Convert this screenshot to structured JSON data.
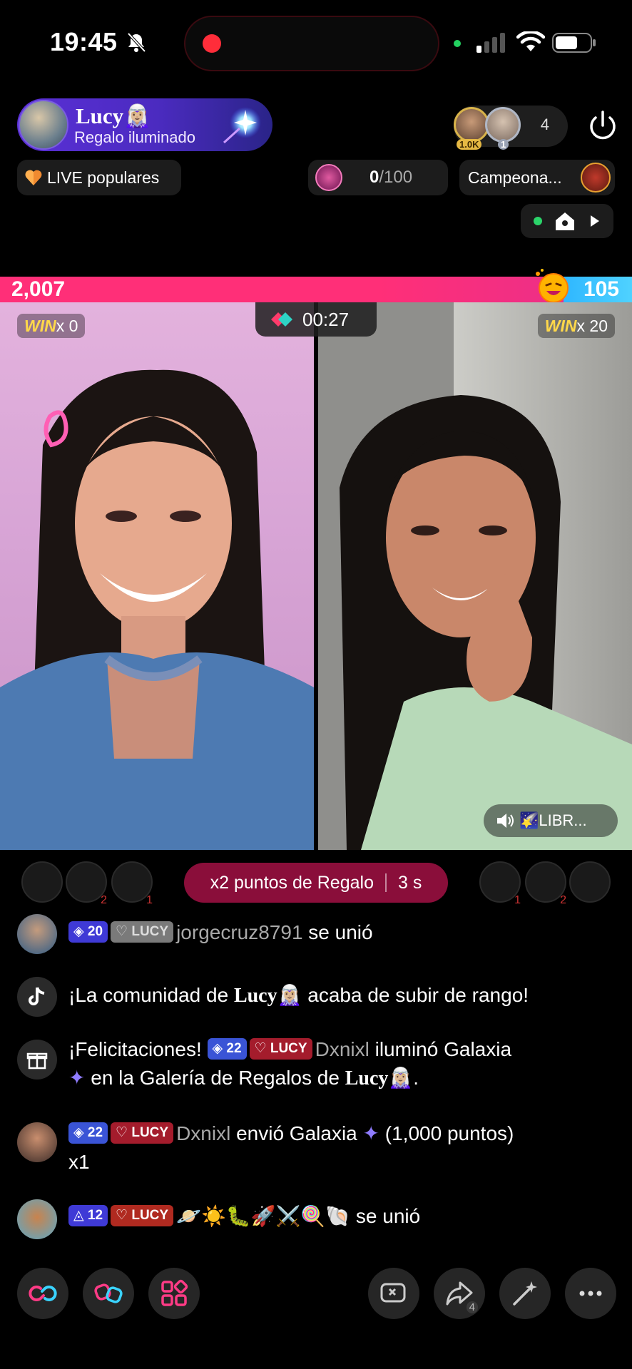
{
  "status_bar": {
    "time": "19:45",
    "icons": [
      "bell-off-icon",
      "recording-dot",
      "signal-icon",
      "wifi-icon",
      "battery-icon"
    ]
  },
  "host": {
    "name": "Lucy🧝🏼‍♀️",
    "subtitle": "Regalo iluminado"
  },
  "viewers": {
    "top1_badge": "1.0K",
    "top2_badge": "1",
    "count": "4"
  },
  "chips": {
    "live": "LIVE populares",
    "goal_current": "0",
    "goal_total": "/100",
    "campaign": "Campeona..."
  },
  "battle": {
    "left_score": "2,007",
    "right_score": "105",
    "timer": "00:27",
    "win_label": "WIN",
    "left_wins": "x 0",
    "right_wins": "x 20",
    "sound_label": "🌠LIBR..."
  },
  "gifters": {
    "left": [
      "",
      "2",
      "1"
    ],
    "right": [
      "1",
      "2",
      ""
    ]
  },
  "bonus": {
    "label": "x2 puntos de Regalo",
    "seconds": "3 s"
  },
  "chat": [
    {
      "level": "20",
      "fan": "LUCY",
      "user": "jorgecruz8791",
      "text": " se unió"
    },
    {
      "text": "¡La comunidad de ",
      "host": "Lucy🧝🏼‍♀️",
      "text2": " acaba de subir de rango!"
    },
    {
      "text": "¡Felicitaciones! ",
      "level": "22",
      "fan": "LUCY",
      "user": "Dxnixl",
      "text2": " iluminó Galaxia",
      "line2a": " en la Galería de Regalos de ",
      "host": "Lucy🧝🏼‍♀️",
      "end": "."
    },
    {
      "level": "22",
      "fan": "LUCY",
      "user": "Dxnixl",
      "text": " envió Galaxia ",
      "text2": " (1,000 puntos)",
      "line2": "x1"
    },
    {
      "level": "12",
      "fan": "LUCY",
      "emojis": "🪐☀️🐛🚀⚔️🍭🐚",
      "text": " se unió"
    }
  ],
  "bottom": {
    "share_count": "4"
  },
  "colors": {
    "pink": "#ff2f78",
    "blue": "#2fb7ff",
    "host_purple": "#5a2fd6",
    "bonus_red": "#8a0e3a"
  }
}
